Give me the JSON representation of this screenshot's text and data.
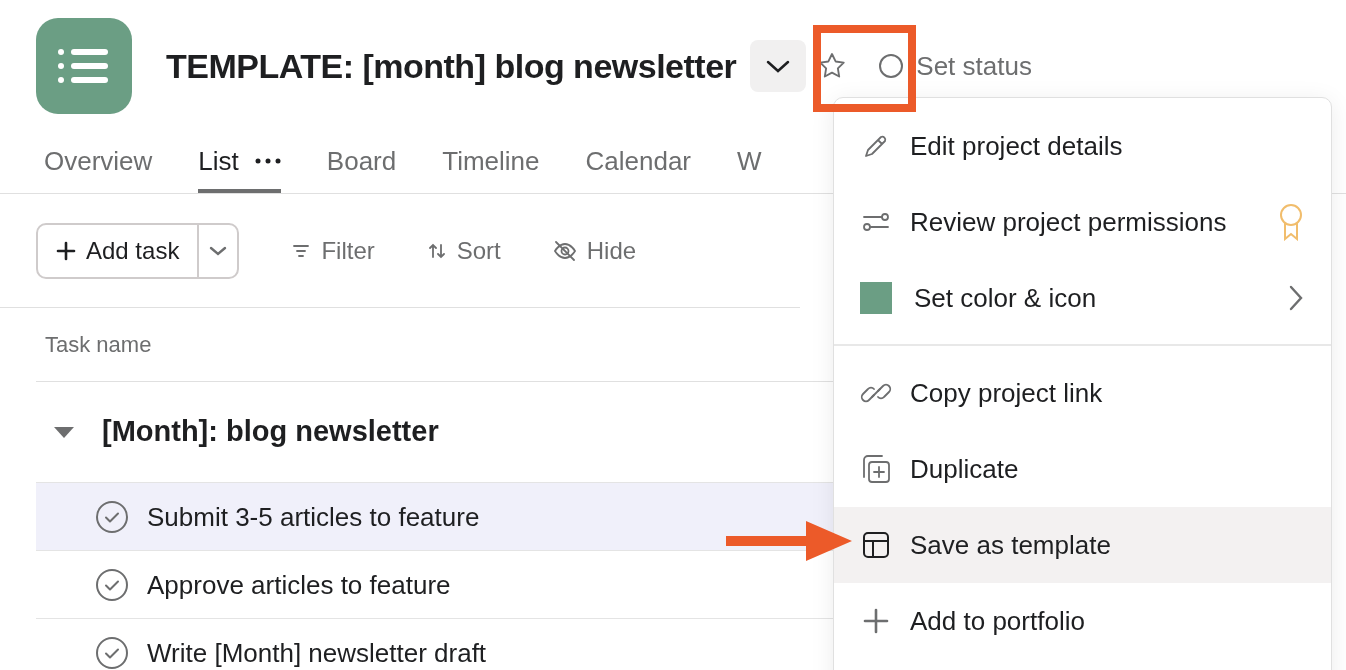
{
  "project": {
    "title": "TEMPLATE: [month] blog newsletter",
    "status": "Set status",
    "color": "#6b9e84"
  },
  "tabs": [
    {
      "label": "Overview",
      "selected": false
    },
    {
      "label": "List",
      "selected": true
    },
    {
      "label": "Board",
      "selected": false
    },
    {
      "label": "Timeline",
      "selected": false
    },
    {
      "label": "Calendar",
      "selected": false
    },
    {
      "label": "W",
      "selected": false
    }
  ],
  "toolbar": {
    "add_task": "Add task",
    "actions": [
      {
        "kind": "filter",
        "label": "Filter"
      },
      {
        "kind": "sort",
        "label": "Sort"
      },
      {
        "kind": "hide",
        "label": "Hide"
      }
    ]
  },
  "table": {
    "column": "Task name",
    "section": {
      "title": "[Month]: blog newsletter",
      "expanded": true
    },
    "rows": [
      {
        "name": "Submit 3-5 articles to feature",
        "selected": true
      },
      {
        "name": "Approve articles to feature",
        "selected": false
      },
      {
        "name": "Write [Month] newsletter draft",
        "selected": false
      }
    ]
  },
  "menu": {
    "groups": [
      [
        {
          "kind": "pencil",
          "label": "Edit project details",
          "highlighted": false
        },
        {
          "kind": "permissions",
          "label": "Review project permissions",
          "highlighted": false,
          "badge": true
        },
        {
          "kind": "color",
          "label": "Set color & icon",
          "highlighted": false,
          "submenu": true,
          "color": "#6b9e84"
        }
      ],
      [
        {
          "kind": "link",
          "label": "Copy project link",
          "highlighted": false
        },
        {
          "kind": "duplicate",
          "label": "Duplicate",
          "highlighted": false
        },
        {
          "kind": "template",
          "label": "Save as template",
          "highlighted": true
        },
        {
          "kind": "plus",
          "label": "Add to portfolio",
          "highlighted": false
        }
      ]
    ]
  }
}
